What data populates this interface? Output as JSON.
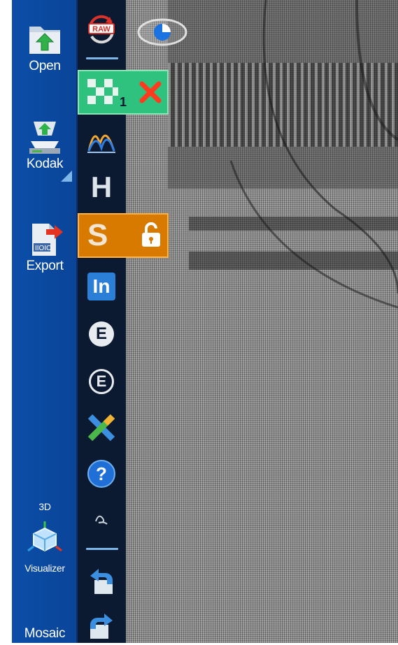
{
  "left_toolbar": {
    "open_label": "Open",
    "kodak_label": "Kodak",
    "export_label": "Export",
    "visualizer_badge": "3D",
    "visualizer_label": "Visualizer",
    "mosaic_label": "Mosaic"
  },
  "tool_toolbar": {
    "raw_label": "RAW",
    "tile_badge": "1",
    "h_label": "H",
    "s_label": "S",
    "in_label": "In",
    "e_label": "E",
    "e2_label": "E",
    "help_label": "?"
  },
  "icons": [
    "folder-open-icon",
    "scanner-icon",
    "export-icon",
    "cube-3d-icon",
    "mosaic-icon",
    "raw-refresh-icon",
    "checkerboard-icon",
    "close-icon",
    "curve-icon",
    "h-icon",
    "s-icon",
    "unlock-icon",
    "linkedin-icon",
    "e-circle-icon",
    "e-bracket-icon",
    "excel-icon",
    "help-icon",
    "signature-icon",
    "undo-icon",
    "redo-icon",
    "eye-icon"
  ],
  "colors": {
    "left_bar": "#0b4ea8",
    "tool_bar": "#0b1a30",
    "green_overlay": "#2ec27e",
    "orange_overlay": "#d97a00",
    "separator": "#7fb6e8"
  }
}
